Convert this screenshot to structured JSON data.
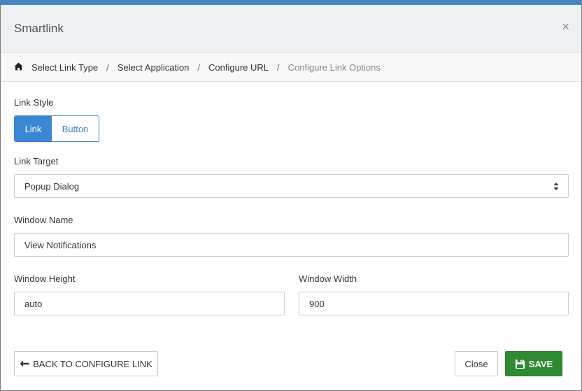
{
  "dialog": {
    "title": "Smartlink",
    "close_glyph": "×"
  },
  "breadcrumb": {
    "home_icon": "home-icon",
    "separator": "/",
    "items": [
      {
        "label": "Select Link Type"
      },
      {
        "label": "Select Application"
      },
      {
        "label": "Configure URL"
      },
      {
        "label": "Configure Link Options",
        "active": true
      }
    ]
  },
  "form": {
    "link_style": {
      "label": "Link Style",
      "options": [
        "Link",
        "Button"
      ],
      "selected": "Link"
    },
    "link_target": {
      "label": "Link Target",
      "value": "Popup Dialog"
    },
    "window_name": {
      "label": "Window Name",
      "value": "View Notifications"
    },
    "window_height": {
      "label": "Window Height",
      "value": "auto"
    },
    "window_width": {
      "label": "Window Width",
      "value": "900"
    }
  },
  "footer": {
    "back_label": "BACK TO CONFIGURE LINK",
    "close_label": "Close",
    "save_label": "SAVE"
  },
  "colors": {
    "accent": "#3a87d6",
    "save": "#2e8b32",
    "header_bg": "#eef1f4"
  }
}
